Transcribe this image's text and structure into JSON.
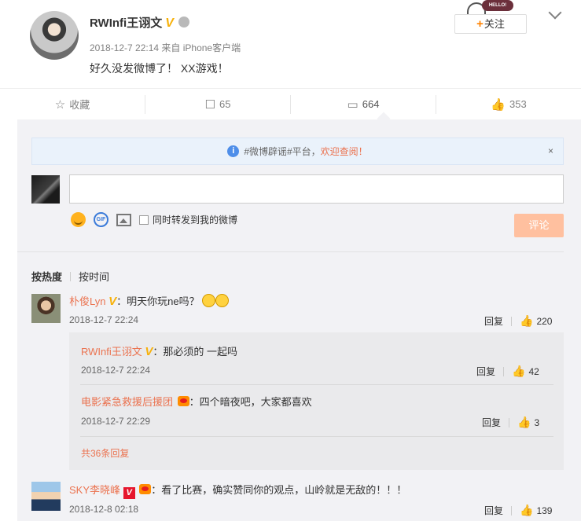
{
  "post": {
    "author": "RWInfi王诩文",
    "v_badge": "V",
    "meta": "2018-12-7 22:14 来自 iPhone客户端",
    "text": "好久没发微博了！ XX游戏！",
    "follow_plus": "+",
    "follow_label": "关注",
    "hello_bubble": "HELLO!"
  },
  "actions": {
    "favorite": "收藏",
    "repost_count": "65",
    "comment_count": "664",
    "like_count": "353"
  },
  "notice": {
    "icon": "i",
    "prefix": "#微博辟谣#平台，",
    "link": "欢迎查阅！",
    "close": "×"
  },
  "compose": {
    "placeholder": "",
    "repost_checkbox_label": "同时转发到我的微博",
    "gif_label": "GIF",
    "submit_label": "评论"
  },
  "sort": {
    "hot": "按热度",
    "time": "按时间"
  },
  "comments": [
    {
      "user": "朴俊Lyn",
      "v": "V",
      "text": "：明天你玩ne吗？",
      "time": "2018-12-7 22:24",
      "reply_label": "回复",
      "likes": "220",
      "replies": [
        {
          "user": "RWInfi王诩文",
          "v": "V",
          "text": "：那必须的 一起吗",
          "time": "2018-12-7 22:24",
          "reply_label": "回复",
          "likes": "42"
        },
        {
          "user": "电影紧急救援后援团",
          "text": "：四个暗夜吧，大家都喜欢",
          "time": "2018-12-7 22:29",
          "reply_label": "回复",
          "likes": "3"
        }
      ],
      "more_replies": "共36条回复"
    },
    {
      "user": "SKY李晓峰",
      "v": "V",
      "text": "：看了比赛，确实赞同你的观点，山岭就是无敌的！！！",
      "time": "2018-12-8 02:18",
      "reply_label": "回复",
      "likes": "139"
    }
  ],
  "colors": {
    "accent_orange": "#ff8200",
    "link_orange": "#eb7350",
    "v_gold": "#f7b10a",
    "submit_disabled": "#ffc09f",
    "notice_blue": "#4e8ee9"
  },
  "icons": {
    "favorite": "star-icon",
    "repost": "repost-icon",
    "comment": "comment-icon",
    "like": "thumbs-up-icon"
  }
}
